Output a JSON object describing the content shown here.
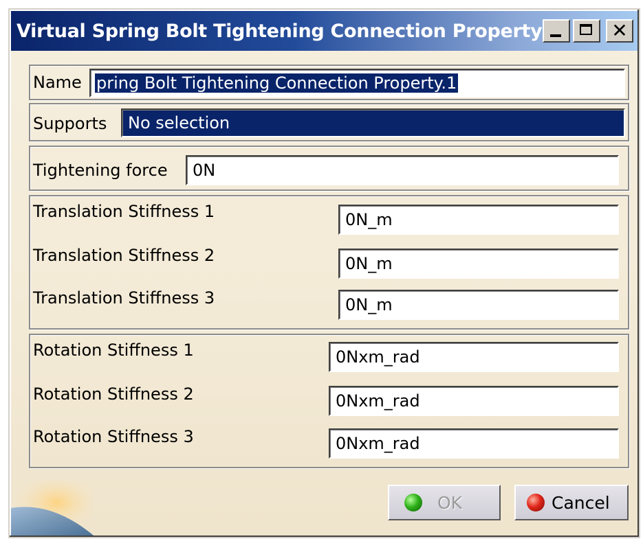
{
  "window": {
    "title": "Virtual Spring Bolt Tightening Connection Property",
    "controls": {
      "minimize_icon": "minimize-icon",
      "maximize_icon": "maximize-icon",
      "close_icon": "close-icon",
      "close_glyph": "✕"
    }
  },
  "name_row": {
    "label": "Name",
    "value": "pring Bolt Tightening Connection Property.1"
  },
  "supports_row": {
    "label": "Supports",
    "value": "No selection"
  },
  "tightening_row": {
    "label": "Tightening force",
    "value": "0N"
  },
  "translation": [
    {
      "label": "Translation Stiffness 1",
      "value": "0N_m"
    },
    {
      "label": "Translation Stiffness 2",
      "value": "0N_m"
    },
    {
      "label": "Translation Stiffness 3",
      "value": "0N_m"
    }
  ],
  "rotation": [
    {
      "label": "Rotation Stiffness 1",
      "value": "0Nxm_rad"
    },
    {
      "label": "Rotation Stiffness 2",
      "value": "0Nxm_rad"
    },
    {
      "label": "Rotation Stiffness 3",
      "value": "0Nxm_rad"
    }
  ],
  "buttons": {
    "ok": {
      "label": "OK",
      "icon": "green-led-icon",
      "enabled": false
    },
    "cancel": {
      "label": "Cancel",
      "icon": "red-led-icon",
      "enabled": true
    }
  },
  "colors": {
    "title_bar": "#0a246a",
    "selection": "#0a246a",
    "background": "#f3ead6"
  }
}
